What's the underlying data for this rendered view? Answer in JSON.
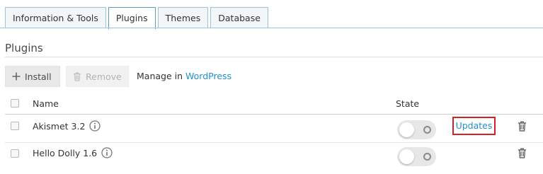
{
  "tabs": [
    {
      "label": "Information & Tools",
      "active": false
    },
    {
      "label": "Plugins",
      "active": true
    },
    {
      "label": "Themes",
      "active": false
    },
    {
      "label": "Database",
      "active": false
    }
  ],
  "section": {
    "title": "Plugins"
  },
  "toolbar": {
    "install_label": "Install",
    "remove_label": "Remove",
    "manage_prefix": "Manage in",
    "manage_link": "WordPress"
  },
  "table": {
    "columns": {
      "name": "Name",
      "state": "State"
    },
    "rows": [
      {
        "name": "Akismet 3.2",
        "enabled": false,
        "update_label": "Updates"
      },
      {
        "name": "Hello Dolly 1.6",
        "enabled": false
      }
    ]
  },
  "colors": {
    "link": "#1f8fd0",
    "highlight_border": "#d71f26",
    "tab_border": "#9cc4d9"
  },
  "icons": [
    "plus-icon",
    "trash-icon",
    "info-icon",
    "toggle-off-icon"
  ]
}
